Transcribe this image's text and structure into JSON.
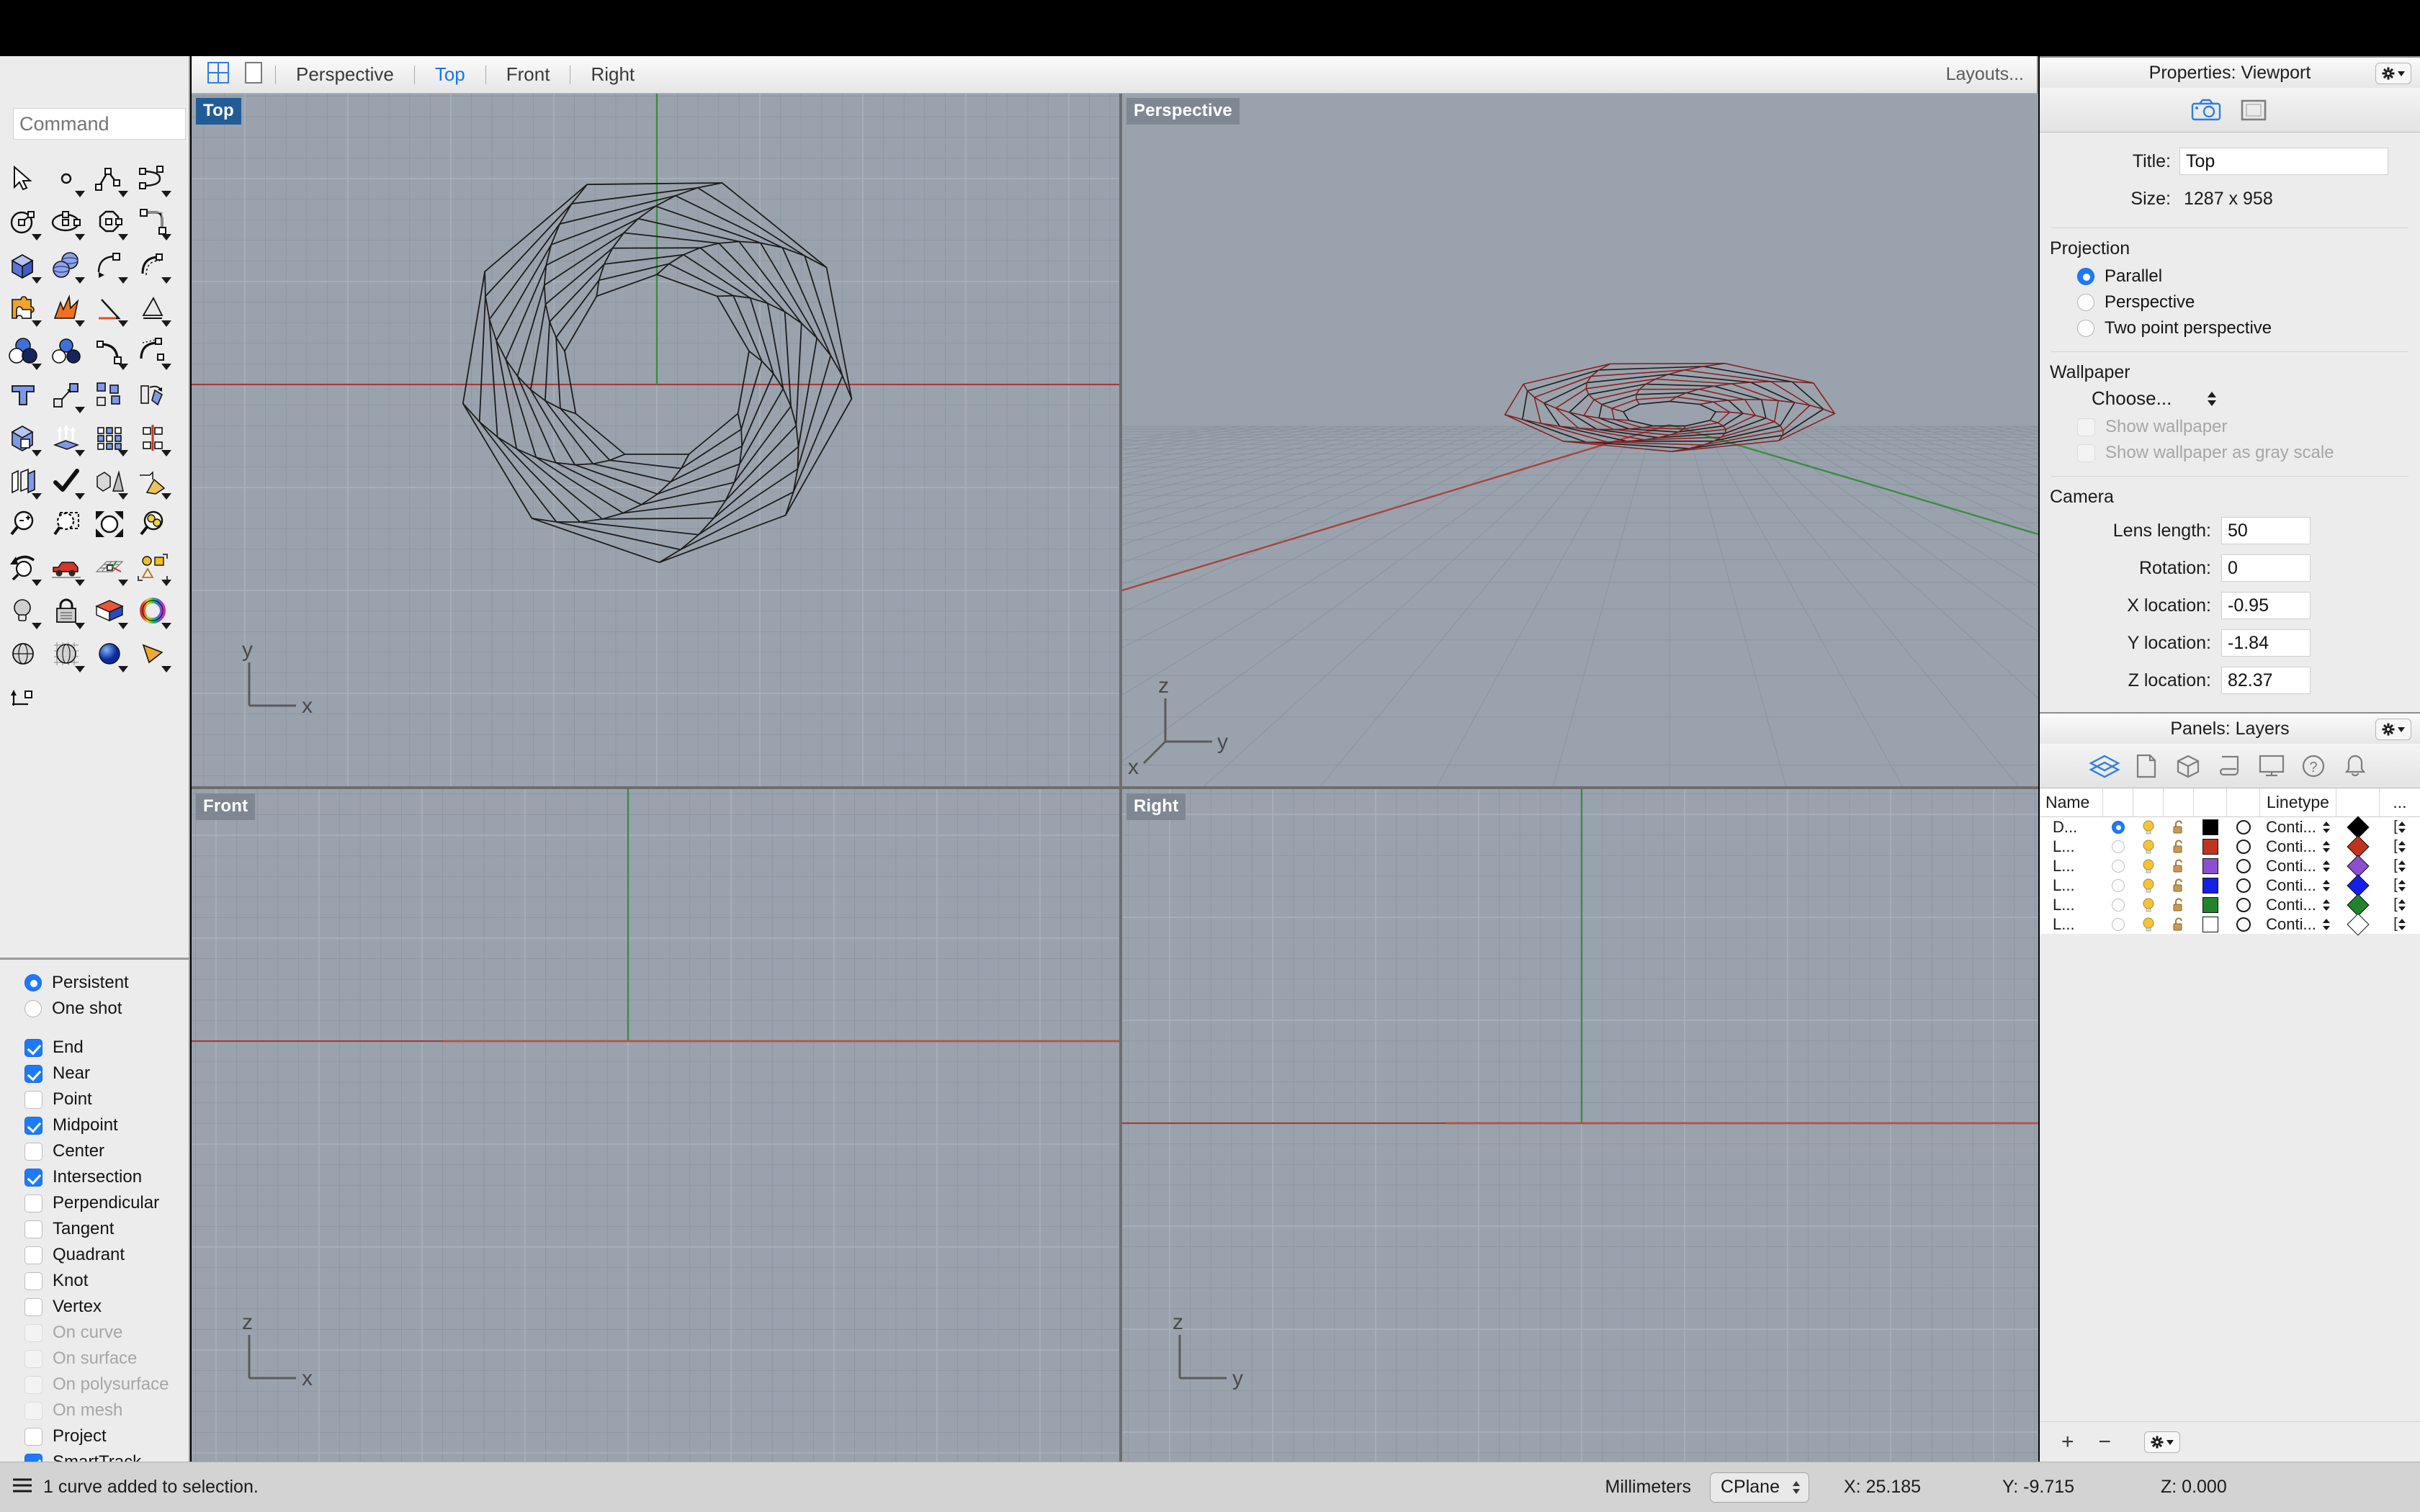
{
  "command": {
    "placeholder": "Command",
    "value": ""
  },
  "viewport_tabs": {
    "four_view_icon": "four-viewport-layout-icon",
    "single_view_icon": "single-viewport-layout-icon",
    "items": [
      {
        "label": "Perspective",
        "active": false
      },
      {
        "label": "Top",
        "active": true
      },
      {
        "label": "Front",
        "active": false
      },
      {
        "label": "Right",
        "active": false
      }
    ],
    "layouts_label": "Layouts..."
  },
  "viewports": [
    {
      "name": "Top",
      "selected": true
    },
    {
      "name": "Perspective",
      "selected": false
    },
    {
      "name": "Front",
      "selected": false
    },
    {
      "name": "Right",
      "selected": false
    }
  ],
  "viewport_axes": {
    "top": [
      "y",
      "x"
    ],
    "perspective": [
      "z",
      "x",
      "y"
    ],
    "front": [
      "z",
      "x"
    ],
    "right": [
      "z",
      "y"
    ]
  },
  "properties": {
    "title": "Properties: Viewport",
    "gear_icon": "gear-dropdown-icon",
    "tabs": [
      "camera-icon",
      "viewport-frame-icon"
    ],
    "title_label": "Title:",
    "title_value": "Top",
    "size_label": "Size:",
    "size_value": "1287 x 958",
    "projection": {
      "heading": "Projection",
      "options": [
        {
          "label": "Parallel",
          "selected": true
        },
        {
          "label": "Perspective",
          "selected": false
        },
        {
          "label": "Two point perspective",
          "selected": false
        }
      ]
    },
    "wallpaper": {
      "heading": "Wallpaper",
      "choose_label": "Choose...",
      "checkboxes": [
        {
          "label": "Show wallpaper",
          "checked": false,
          "disabled": true
        },
        {
          "label": "Show wallpaper as gray scale",
          "checked": false,
          "disabled": true
        }
      ]
    },
    "camera": {
      "heading": "Camera",
      "fields": [
        {
          "label": "Lens length:",
          "value": "50"
        },
        {
          "label": "Rotation:",
          "value": "0"
        },
        {
          "label": "X location:",
          "value": "-0.95"
        },
        {
          "label": "Y location:",
          "value": "-1.84"
        },
        {
          "label": "Z location:",
          "value": "82.37"
        }
      ]
    }
  },
  "layers_panel": {
    "title": "Panels: Layers",
    "gear_icon": "gear-dropdown-icon",
    "tabs": [
      "layers-icon",
      "properties-page-icon",
      "object-cube-icon",
      "named-views-scroll-icon",
      "display-monitor-icon",
      "help-question-icon",
      "notifications-bell-icon"
    ],
    "columns": [
      "Name",
      "",
      "",
      "",
      "",
      "",
      "Linetype",
      "",
      "..."
    ],
    "rows": [
      {
        "name": "D...",
        "current": true,
        "on": true,
        "locked": false,
        "color": "#000000",
        "linetype": "Conti...",
        "print_color": "#000000"
      },
      {
        "name": "L...",
        "current": false,
        "on": true,
        "locked": false,
        "color": "#c1331f",
        "linetype": "Conti...",
        "print_color": "#c1331f"
      },
      {
        "name": "L...",
        "current": false,
        "on": true,
        "locked": false,
        "color": "#8b4fd1",
        "linetype": "Conti...",
        "print_color": "#8b4fd1"
      },
      {
        "name": "L...",
        "current": false,
        "on": true,
        "locked": false,
        "color": "#1420e8",
        "linetype": "Conti...",
        "print_color": "#1420e8"
      },
      {
        "name": "L...",
        "current": false,
        "on": true,
        "locked": false,
        "color": "#21842b",
        "linetype": "Conti...",
        "print_color": "#21842b"
      },
      {
        "name": "L...",
        "current": false,
        "on": true,
        "locked": false,
        "color": "#ffffff",
        "linetype": "Conti...",
        "print_color": "#ffffff"
      }
    ],
    "footer": {
      "add": "+",
      "remove": "−",
      "gear": "gear-dropdown-icon"
    }
  },
  "osnap": {
    "mode": [
      {
        "label": "Persistent",
        "selected": true
      },
      {
        "label": "One shot",
        "selected": false
      }
    ],
    "snaps": [
      {
        "label": "End",
        "checked": true,
        "disabled": false
      },
      {
        "label": "Near",
        "checked": true,
        "disabled": false
      },
      {
        "label": "Point",
        "checked": false,
        "disabled": false
      },
      {
        "label": "Midpoint",
        "checked": true,
        "disabled": false
      },
      {
        "label": "Center",
        "checked": false,
        "disabled": false
      },
      {
        "label": "Intersection",
        "checked": true,
        "disabled": false
      },
      {
        "label": "Perpendicular",
        "checked": false,
        "disabled": false
      },
      {
        "label": "Tangent",
        "checked": false,
        "disabled": false
      },
      {
        "label": "Quadrant",
        "checked": false,
        "disabled": false
      },
      {
        "label": "Knot",
        "checked": false,
        "disabled": false
      },
      {
        "label": "Vertex",
        "checked": false,
        "disabled": false
      },
      {
        "label": "On curve",
        "checked": false,
        "disabled": true
      },
      {
        "label": "On surface",
        "checked": false,
        "disabled": true
      },
      {
        "label": "On polysurface",
        "checked": false,
        "disabled": true
      },
      {
        "label": "On mesh",
        "checked": false,
        "disabled": true
      },
      {
        "label": "Project",
        "checked": false,
        "disabled": false
      },
      {
        "label": "SmartTrack",
        "checked": true,
        "disabled": false
      }
    ]
  },
  "statusbar": {
    "menu_icon": "hamburger-menu-icon",
    "message": "1 curve added to selection.",
    "units": "Millimeters",
    "cplane": "CPlane",
    "x": "X: 25.185",
    "y": "Y: -9.715",
    "z": "Z: 0.000"
  },
  "toolbar_icons": [
    [
      "arrow-select-icon",
      "point-icon",
      "polyline-icon",
      "curve-interpolate-icon"
    ],
    [
      "circle-icon",
      "ellipse-icon",
      "polygon-icon",
      "arc-fillet-icon"
    ],
    [
      "box-icon",
      "sphere-boolean-icon",
      "surface-edge-icon",
      "surface-loft-icon"
    ],
    [
      "puzzle-plugin-icon",
      "explode-flame-icon",
      "analyze-angle-icon",
      "dimension-icon"
    ],
    [
      "boolean-union-icon",
      "boolean-difference-icon",
      "curve-edit-point-icon",
      "curve-rebuild-icon"
    ],
    [
      "text-icon",
      "move-icon",
      "copy-icon",
      "rotate-icon"
    ],
    [
      "cap-solid-icon",
      "extrude-icon",
      "array-icon",
      "mirror-icon"
    ],
    [
      "offset-surface-icon",
      "select-check-icon",
      "shade-object-icon",
      "gumball-pyramid-icon"
    ],
    [
      "zoom-icon",
      "zoom-window-icon",
      "zoom-extents-icon",
      "zoom-selected-icon"
    ],
    [
      "zoom-previous-icon",
      "pan-car-icon",
      "cplane-grid-icon",
      "select-objects-icon"
    ],
    [
      "light-bulb-icon",
      "lock-icon",
      "material-icon",
      "color-wheel-icon"
    ],
    [
      "render-wireframe-icon",
      "render-ghosted-icon",
      "render-preview-icon",
      "render-camera-icon"
    ],
    [
      "dimension-linear-icon",
      "",
      "",
      ""
    ]
  ]
}
